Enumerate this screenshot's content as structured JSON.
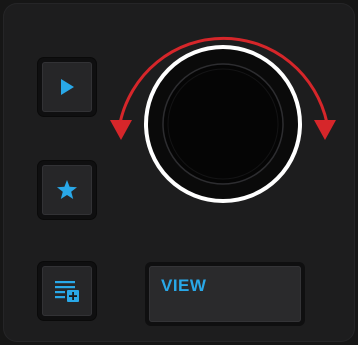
{
  "controller": {
    "view_button": {
      "label": "VIEW"
    }
  },
  "icons": {
    "play": "play-icon",
    "favorite": "star-icon",
    "prep_list_add": "playlist-add-icon",
    "rotate": "rotate-arrows-icon"
  },
  "colors": {
    "accent": "#29a8e8",
    "arrow": "#d6262a",
    "knob_ring": "#ffffff",
    "background": "#1d1d1e"
  }
}
